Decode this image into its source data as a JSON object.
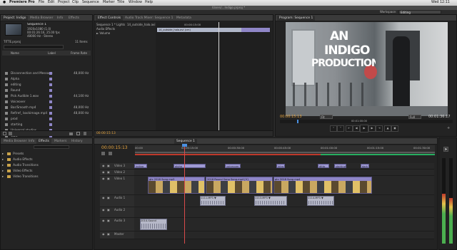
{
  "menubar": {
    "app_name": "Premiere Pro",
    "items": [
      "File",
      "Edit",
      "Project",
      "Clip",
      "Sequence",
      "Marker",
      "Title",
      "Window",
      "Help"
    ],
    "clock": "Wed 12:11"
  },
  "window_title": "/Users/...Indigo.prproj *",
  "workspace": {
    "label": "Workspace:",
    "value": "Editing"
  },
  "project_panel": {
    "tabs": [
      "Project: Indigo",
      "Media Browser",
      "Info",
      "Effects"
    ],
    "preview": {
      "name": "Sequence 1",
      "details_1": "1920x1080 (1.0)",
      "details_2": "00:01:26:16, 25.00 fps",
      "details_3": "48000 Hz - Stereo"
    },
    "project_name": "TITTE.prproj",
    "item_count": "11 Items",
    "search_placeholder": "",
    "columns": [
      "Name",
      "Label",
      "Frame Rate"
    ],
    "items": [
      {
        "name": "Disconnection and Message",
        "rate": "48,000 Hz",
        "label_color": "#8f86c7"
      },
      {
        "name": "Alpha",
        "rate": "",
        "label_color": "#8f86c7"
      },
      {
        "name": "editing",
        "rate": "",
        "label_color": "#8f86c7"
      },
      {
        "name": "Round",
        "rate": "",
        "label_color": "#8f86c7"
      },
      {
        "name": "Pick Audible 1.wav",
        "rate": "44,100 Hz",
        "label_color": "#8f86c7"
      },
      {
        "name": "Voiceover",
        "rate": "",
        "label_color": "#8f86c7"
      },
      {
        "name": "Bar/Smooth mp4",
        "rate": "48,000 Hz",
        "label_color": "#8f86c7"
      },
      {
        "name": "Ref/ref_ backimage.mp4",
        "rate": "48,000 Hz",
        "label_color": "#8f86c7"
      },
      {
        "name": "prod",
        "rate": "",
        "label_color": "#8f86c7"
      },
      {
        "name": "starting",
        "rate": "",
        "label_color": "#8f86c7"
      },
      {
        "name": "Universal studios",
        "rate": "",
        "label_color": "#8f86c7"
      },
      {
        "name": "Wait",
        "rate": "",
        "label_color": "#8f86c7"
      },
      {
        "name": "Sequence 1",
        "rate": "25.00 fps",
        "label_color": "#4caf50"
      }
    ]
  },
  "source_panel": {
    "tabs": [
      "Effect Controls",
      "Audio Track Mixer: Sequence 1",
      "Metadata"
    ],
    "sequence": "Sequence 1 * Lights",
    "clip": "14_outside_halo.avi",
    "section": "Audio Effects",
    "effect": "Volume",
    "timecode_ruler": "00:00:15:00",
    "clip_bar_label": "14_outside_halo.avi (cm)",
    "current_time": "00:00:15:13"
  },
  "program_monitor": {
    "tab": "Program: Sequence 1",
    "title_line_1": "AN",
    "title_line_2": "INDIGO",
    "title_line_3": "PRODUCTION",
    "timecode_current": "00:00:15:13",
    "timecode_duration": "00:01:36:17",
    "fit": "Fit",
    "quality": "Full",
    "ruler_time": "00:01:00:00"
  },
  "effects_panel": {
    "tabs": [
      "Media Browser",
      "Info",
      "Effects",
      "Markers",
      "History"
    ],
    "folders": [
      "Presets",
      "Audio Effects",
      "Audio Transitions",
      "Video Effects",
      "Video Transitions"
    ]
  },
  "timeline": {
    "tab": "Sequence 1",
    "timecode": "00:00:15:13",
    "ruler_labels": [
      "00:00",
      "00:00:15:00",
      "00:00:30:00",
      "00:00:45:00",
      "00:01:00:00",
      "00:01:15:00",
      "00:01:30:00"
    ],
    "video_tracks": [
      {
        "name": "Video 3",
        "clips": [
          {
            "label": "indigo"
          },
          {
            "label": "alpha"
          },
          {
            "label": "voiceover"
          },
          {
            "label": "intro"
          },
          {
            "label": "ditto"
          },
          {
            "label": "starting"
          },
          {
            "label": "dark"
          }
        ]
      },
      {
        "name": "Video 2",
        "clips": []
      },
      {
        "name": "Video 1",
        "clips": [
          {
            "label": "gtc 2018 Song mp3"
          },
          {
            "label": "2018 Round Song Song.mp4 [V]"
          },
          {
            "label": "gtc 2018 Song mp4"
          }
        ]
      }
    ],
    "audio_tracks": [
      {
        "name": "Audio 1",
        "clips": [
          {
            "label": "1111.MP3 ▼"
          },
          {
            "label": "1113.MP3 ▼"
          },
          {
            "label": "1114.MP3 ▼"
          }
        ]
      },
      {
        "name": "Audio 2",
        "clips": []
      },
      {
        "name": "Audio 3",
        "clips": [
          {
            "label": "2014-Sound"
          }
        ]
      },
      {
        "name": "Master",
        "clips": []
      }
    ]
  }
}
